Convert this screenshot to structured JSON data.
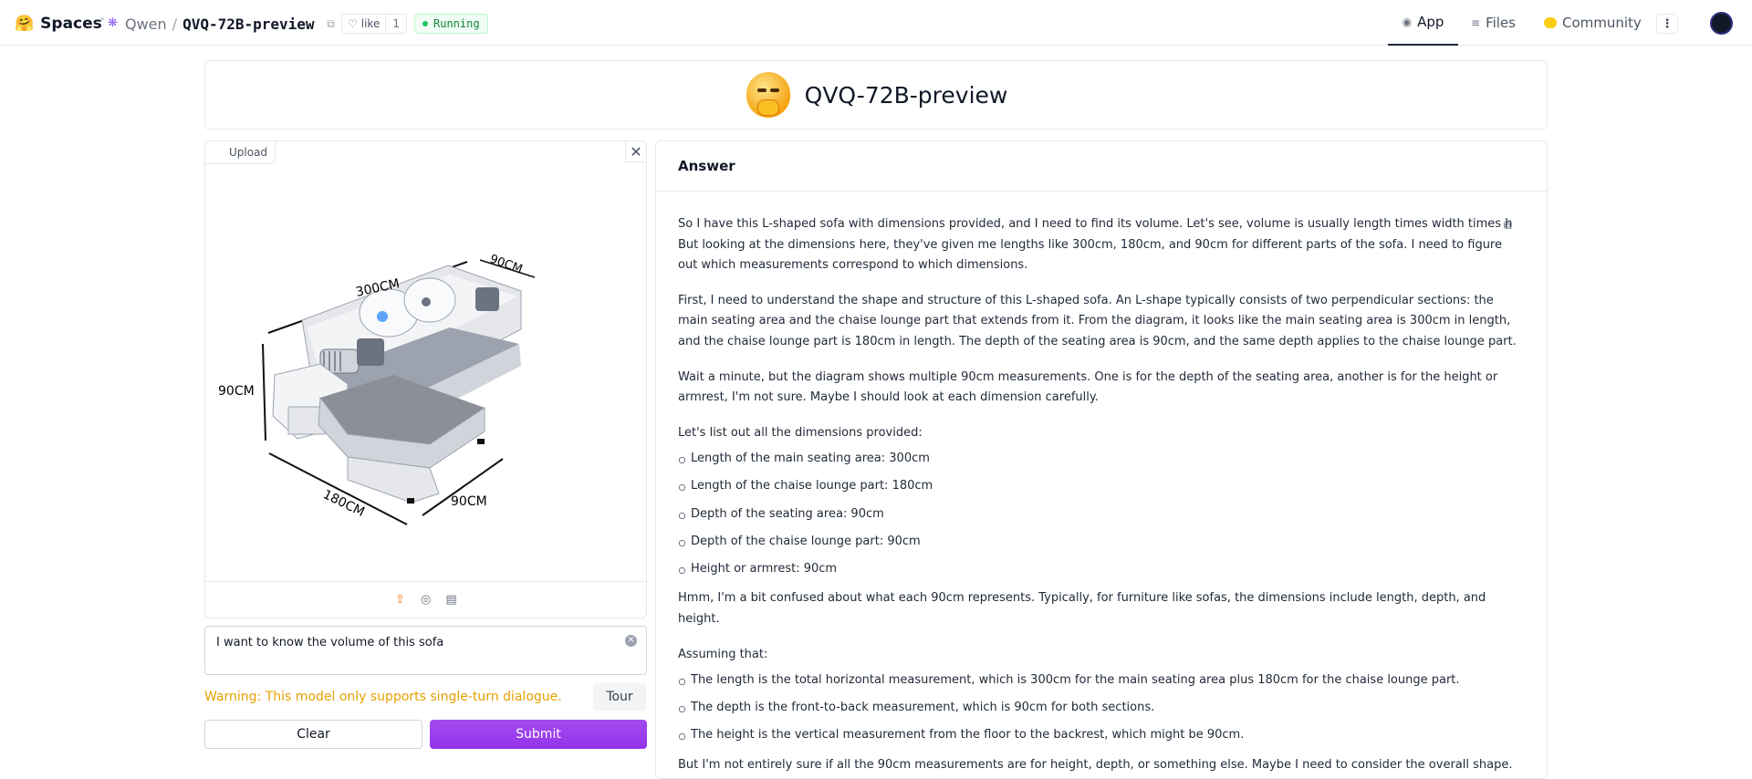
{
  "header": {
    "brand": "Spaces",
    "org": "Qwen",
    "repo": "QVQ-72B-preview",
    "like_label": "like",
    "like_count": "1",
    "status": "Running",
    "tabs": [
      {
        "label": "App",
        "icon": "app-icon"
      },
      {
        "label": "Files",
        "icon": "files-icon"
      },
      {
        "label": "Community",
        "icon": "community-icon"
      }
    ]
  },
  "title": "QVQ-72B-preview",
  "image_panel": {
    "upload_label": "Upload",
    "dimensions": {
      "length_main": "300CM",
      "depth_main": "90CM",
      "height": "90CM",
      "length_chaise": "180CM",
      "depth_chaise": "90CM"
    }
  },
  "prompt": {
    "value": "I want to know the volume of this sofa"
  },
  "warning": "Warning: This model only supports single-turn dialogue.",
  "buttons": {
    "tour": "Tour",
    "clear": "Clear",
    "submit": "Submit"
  },
  "answer": {
    "label": "Answer",
    "p1": "So I have this L-shaped sofa with dimensions provided, and I need to find its volume. Let's see, volume is usually length times width times height, rig",
    "p1b": "But looking at the dimensions here, they've given me lengths like 300cm, 180cm, and 90cm for different parts of the sofa. I need to figure out which measurements correspond to which dimensions.",
    "p2": "First, I need to understand the shape and structure of this L-shaped sofa. An L-shape typically consists of two perpendicular sections: the main seating area and the chaise lounge part that extends from it. From the diagram, it looks like the main seating area is 300cm in length, and the chaise lounge part is 180cm in length. The depth of the seating area is 90cm, and the same depth applies to the chaise lounge part.",
    "p3": "Wait a minute, but the diagram shows multiple 90cm measurements. One is for the depth of the seating area, another is for the height or armrest, I'm not sure. Maybe I should look at each dimension carefully.",
    "p4": "Let's list out all the dimensions provided:",
    "list1": [
      "Length of the main seating area: 300cm",
      "Length of the chaise lounge part: 180cm",
      "Depth of the seating area: 90cm",
      "Depth of the chaise lounge part: 90cm",
      "Height or armrest: 90cm"
    ],
    "p5": "Hmm, I'm a bit confused about what each 90cm represents. Typically, for furniture like sofas, the dimensions include length, depth, and height.",
    "p6": "Assuming that:",
    "list2": [
      "The length is the total horizontal measurement, which is 300cm for the main seating area plus 180cm for the chaise lounge part.",
      "The depth is the front-to-back measurement, which is 90cm for both sections.",
      "The height is the vertical measurement from the floor to the backrest, which might be 90cm."
    ],
    "p7": "But I'm not entirely sure if all the 90cm measurements are for height, depth, or something else. Maybe I need to consider the overall shape."
  },
  "colors": {
    "accent": "#9333ea",
    "warning": "#e6a100",
    "running": "#15803d"
  }
}
